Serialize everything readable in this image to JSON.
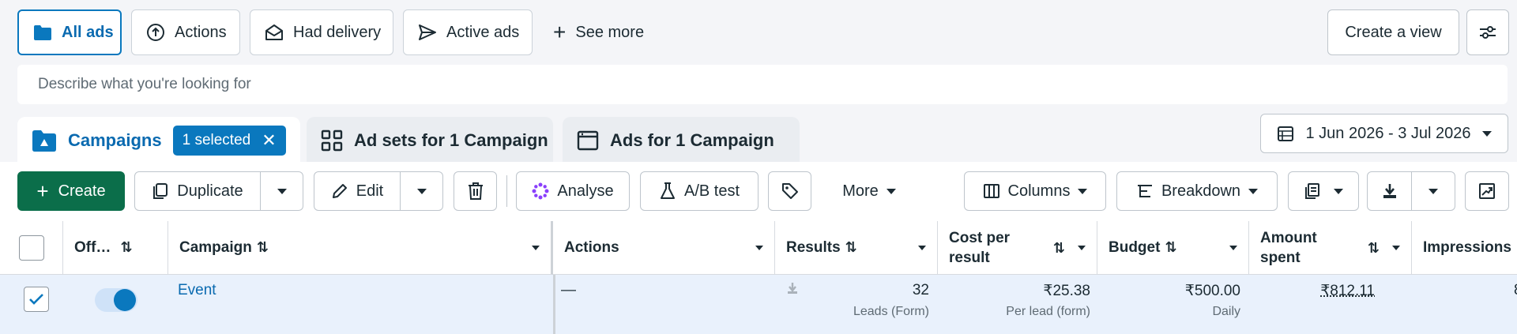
{
  "filters": {
    "all_ads": "All ads",
    "actions": "Actions",
    "had_delivery": "Had delivery",
    "active_ads": "Active ads",
    "see_more": "See more",
    "create_view": "Create a view"
  },
  "search": {
    "placeholder": "Describe what you're looking for"
  },
  "tabs": {
    "campaigns": "Campaigns",
    "selected_badge": "1 selected",
    "ad_sets": "Ad sets for 1 Campaign",
    "ads": "Ads for 1 Campaign"
  },
  "date_range": "1 Jun 2026 - 3 Jul 2026",
  "toolbar": {
    "create": "Create",
    "duplicate": "Duplicate",
    "edit": "Edit",
    "analyse": "Analyse",
    "ab_test": "A/B test",
    "more": "More",
    "columns": "Columns",
    "breakdown": "Breakdown"
  },
  "table": {
    "headers": {
      "off_on": "Off…",
      "campaign": "Campaign",
      "actions": "Actions",
      "results": "Results",
      "cost_per_result_1": "Cost per",
      "cost_per_result_2": "result",
      "budget": "Budget",
      "amount_spent_1": "Amount",
      "amount_spent_2": "spent",
      "impressions": "Impressions"
    },
    "rows": [
      {
        "campaign": "Event",
        "actions": "—",
        "results": "32",
        "results_sub": "Leads (Form)",
        "cost_per_result": "₹25.38",
        "cost_per_result_sub": "Per lead (form)",
        "budget": "₹500.00",
        "budget_sub": "Daily",
        "amount_spent": "₹812.11",
        "impressions_partial": "8"
      }
    ]
  },
  "colors": {
    "accent": "#0a78be",
    "create": "#0b6e4a",
    "selected_row": "#e9f1fc"
  }
}
